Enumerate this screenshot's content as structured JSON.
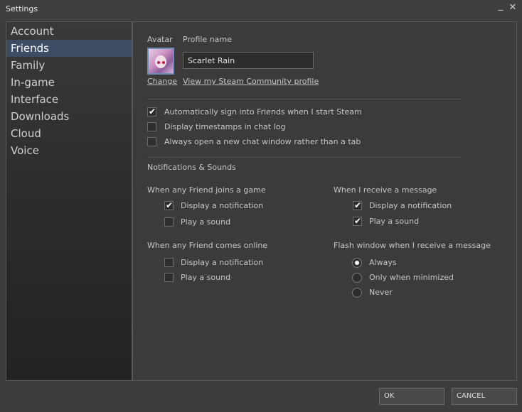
{
  "window": {
    "title": "Settings",
    "minimize_glyph": "_",
    "close_glyph": "✕"
  },
  "sidebar": {
    "items": [
      {
        "label": "Account"
      },
      {
        "label": "Friends",
        "active": true
      },
      {
        "label": "Family"
      },
      {
        "label": "In-game"
      },
      {
        "label": "Interface"
      },
      {
        "label": "Downloads"
      },
      {
        "label": "Cloud"
      },
      {
        "label": "Voice"
      }
    ]
  },
  "profile": {
    "avatar_label": "Avatar",
    "name_label": "Profile name",
    "name_value": "Scarlet Rain",
    "change_link": "Change",
    "community_link": "View my Steam Community profile"
  },
  "options": [
    {
      "label": "Automatically sign into Friends when I start Steam",
      "checked": true
    },
    {
      "label": "Display timestamps in chat log",
      "checked": false
    },
    {
      "label": "Always open a new chat window rather than a tab",
      "checked": false
    }
  ],
  "notifications": {
    "heading": "Notifications & Sounds",
    "join_game": {
      "heading": "When any Friend joins a game",
      "display": {
        "label": "Display a notification",
        "checked": true
      },
      "sound": {
        "label": "Play a sound",
        "checked": false
      }
    },
    "comes_online": {
      "heading": "When any Friend comes online",
      "display": {
        "label": "Display a notification",
        "checked": false
      },
      "sound": {
        "label": "Play a sound",
        "checked": false
      }
    },
    "receive_message": {
      "heading": "When I receive a message",
      "display": {
        "label": "Display a notification",
        "checked": true
      },
      "sound": {
        "label": "Play a sound",
        "checked": true
      }
    },
    "flash_window": {
      "heading": "Flash window when I receive a message",
      "options": [
        {
          "label": "Always",
          "selected": true
        },
        {
          "label": "Only when minimized",
          "selected": false
        },
        {
          "label": "Never",
          "selected": false
        }
      ]
    }
  },
  "buttons": {
    "ok": "OK",
    "cancel": "CANCEL"
  },
  "colors": {
    "accent": "#3e4c63",
    "background": "#3e3d3b",
    "avatar_border": "#6d8db8"
  },
  "icons": {
    "check": "check-icon",
    "radio": "radio-dot-icon"
  }
}
